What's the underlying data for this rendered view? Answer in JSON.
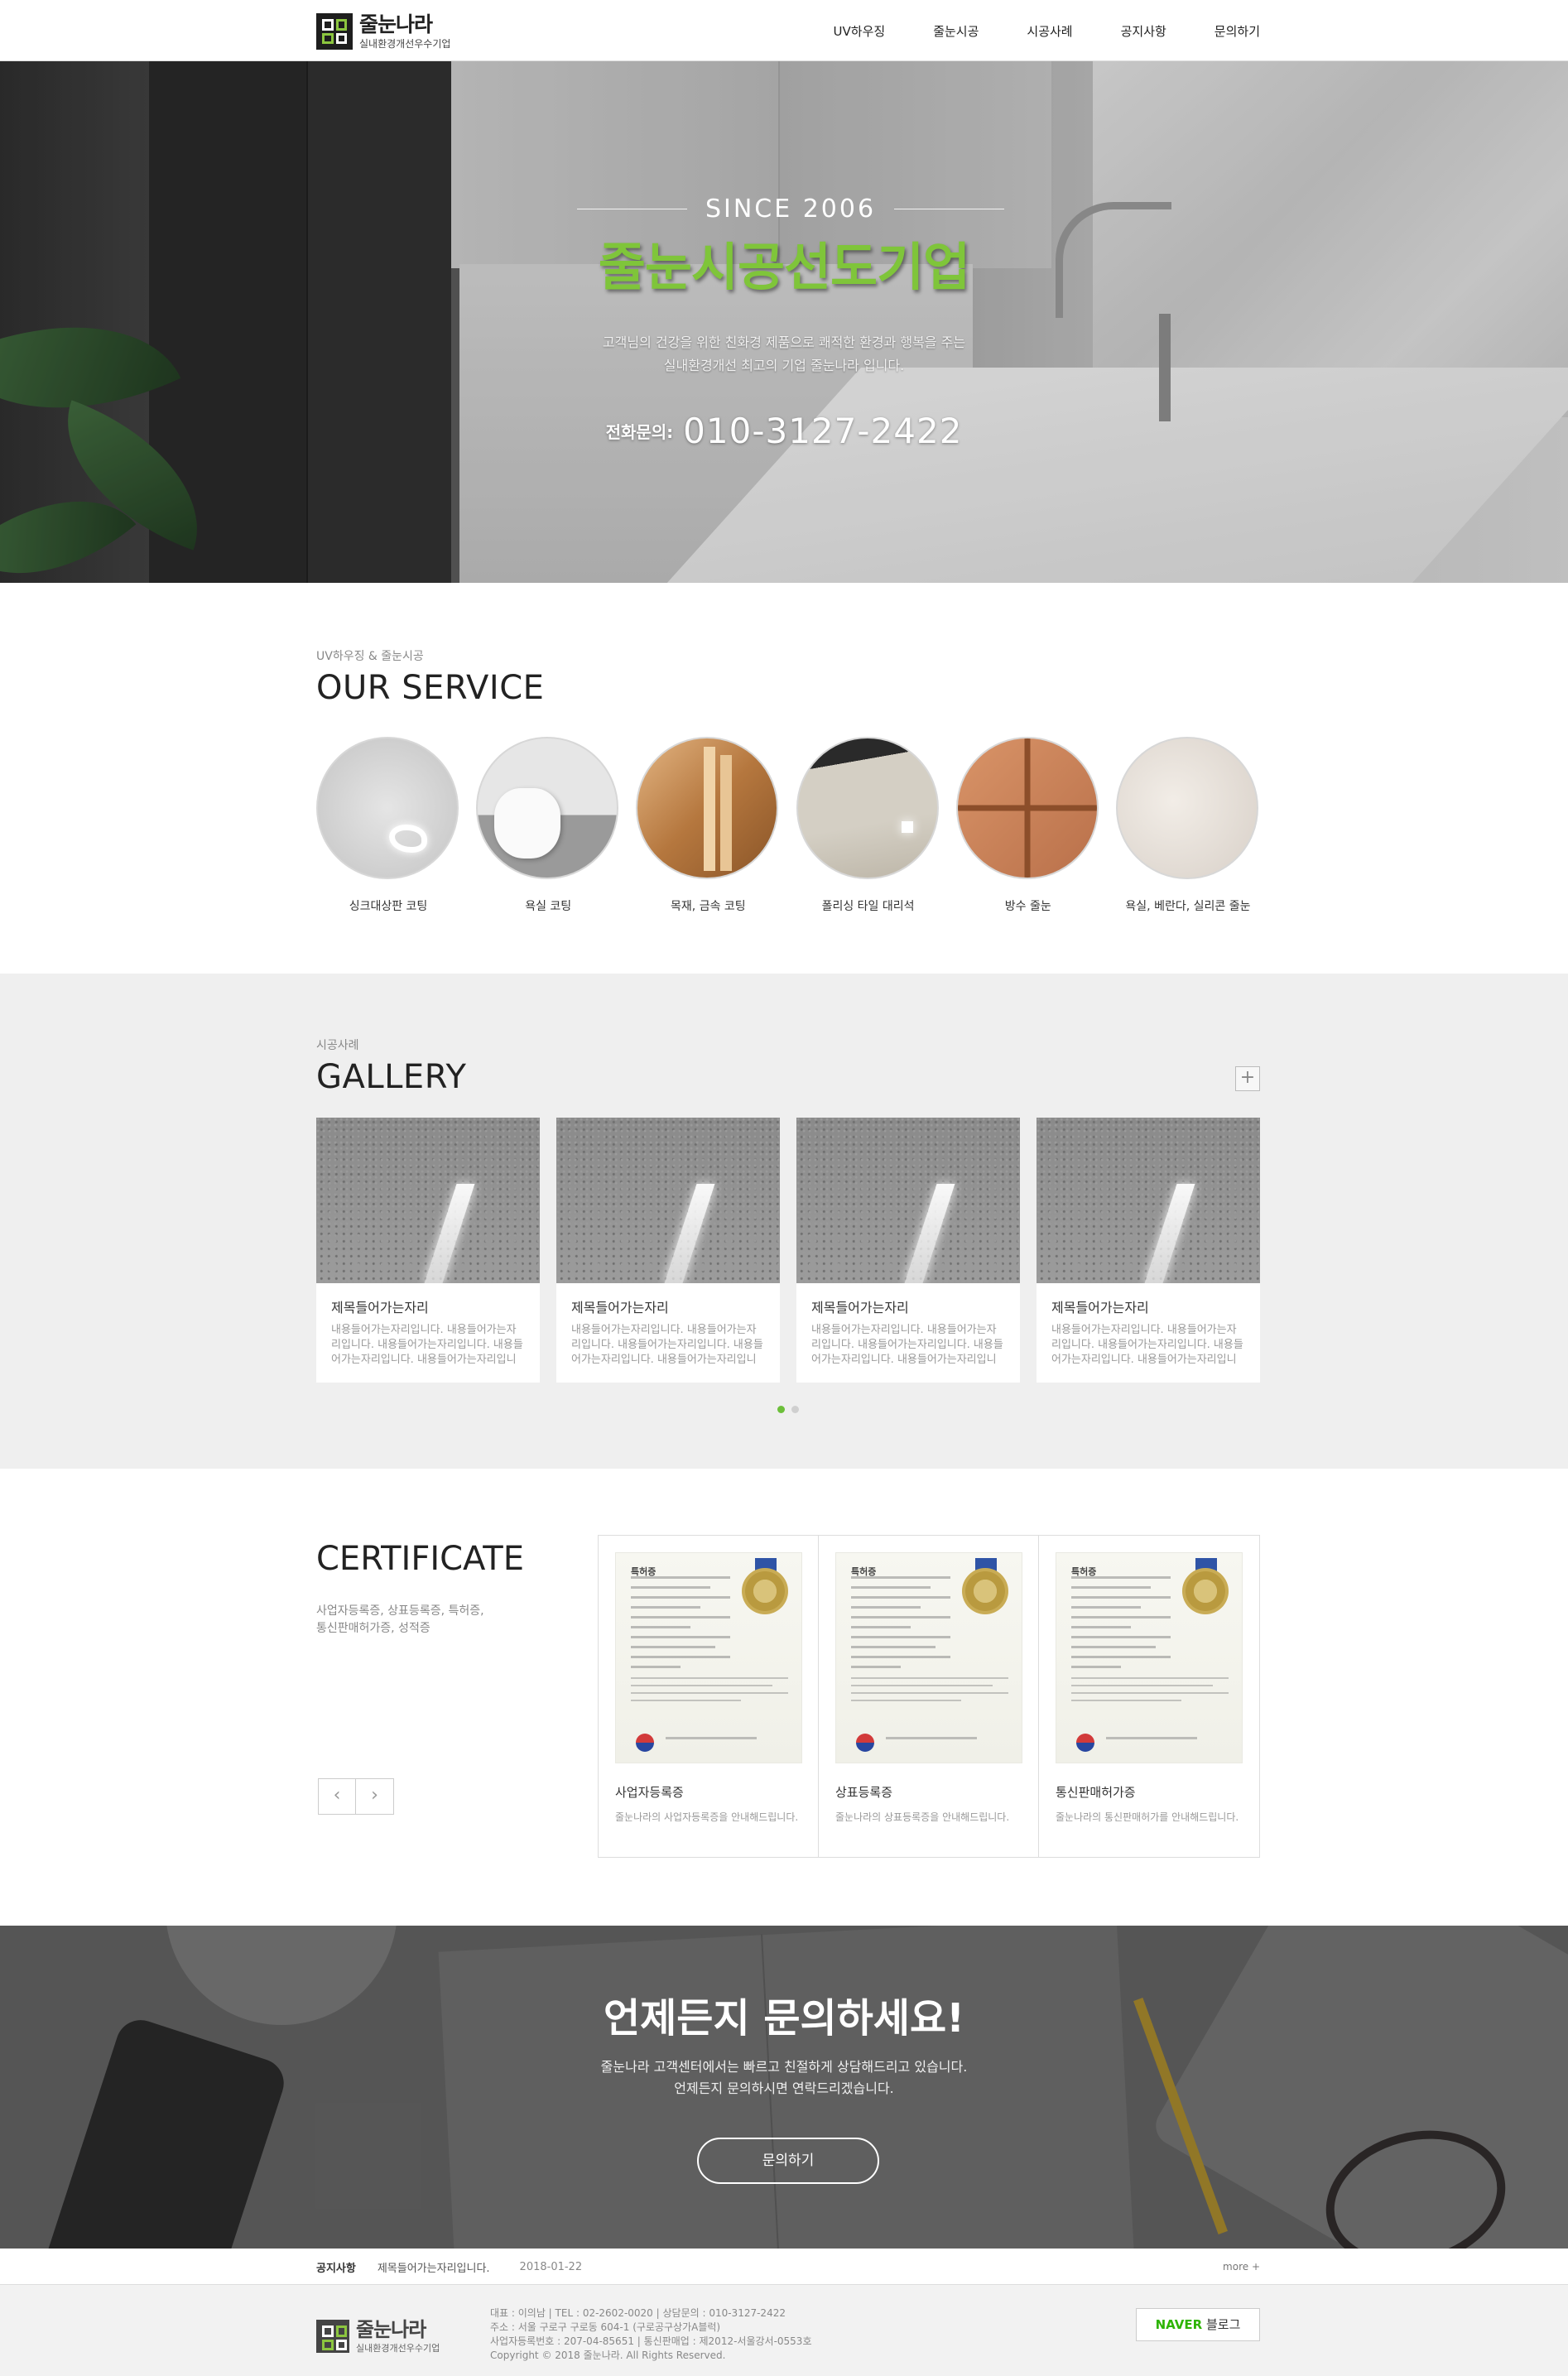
{
  "brand": {
    "name": "줄눈나라",
    "tagline": "실내환경개선우수기업"
  },
  "nav": [
    "UV하우징",
    "줄눈시공",
    "시공사례",
    "공지사항",
    "문의하기"
  ],
  "hero": {
    "since": "SINCE 2006",
    "title": "줄눈시공선도기업",
    "desc_line1": "고객님의 건강을 위한 친화경 제품으로 쾌적한 환경과 행복을 주는",
    "desc_line2": "실내환경개선 최고의 기업 줄눈나라 입니다.",
    "phone_label": "전화문의:",
    "phone": "010-3127-2422"
  },
  "service": {
    "sub": "UV하우징 & 줄눈시공",
    "title": "OUR SERVICE",
    "items": [
      "싱크대상판 코팅",
      "욕실 코팅",
      "목재, 금속 코팅",
      "폴리싱 타일 대리석",
      "방수 줄눈",
      "욕실, 베란다, 실리콘 줄눈"
    ]
  },
  "gallery": {
    "sub": "시공사례",
    "title": "GALLERY",
    "more_icon": "+",
    "cards": [
      {
        "title": "제목들어가는자리",
        "text": "내용들어가는자리입니다. 내용들어가는자리입니다. 내용들어가는자리입니다. 내용들어가는자리입니다. 내용들어가는자리입니다."
      },
      {
        "title": "제목들어가는자리",
        "text": "내용들어가는자리입니다. 내용들어가는자리입니다. 내용들어가는자리입니다. 내용들어가는자리입니다. 내용들어가는자리입니다."
      },
      {
        "title": "제목들어가는자리",
        "text": "내용들어가는자리입니다. 내용들어가는자리입니다. 내용들어가는자리입니다. 내용들어가는자리입니다. 내용들어가는자리입니다."
      },
      {
        "title": "제목들어가는자리",
        "text": "내용들어가는자리입니다. 내용들어가는자리입니다. 내용들어가는자리입니다. 내용들어가는자리입니다. 내용들어가는자리입니다."
      }
    ],
    "active_page": 1,
    "pages": 2
  },
  "certificate": {
    "title": "CERTIFICATE",
    "desc_line1": "사업자등록증, 상표등록증, 특허증,",
    "desc_line2": "통신판매허가증, 성적증",
    "prev_icon": "‹",
    "next_icon": "›",
    "doc_head": "특허증",
    "items": [
      {
        "name": "사업자등록증",
        "text": "줄눈나라의 사업자등록증을 안내해드립니다."
      },
      {
        "name": "상표등록증",
        "text": "줄눈나라의 상표등록증을 안내해드립니다."
      },
      {
        "name": "통신판매허가증",
        "text": "줄눈나라의 통신판매허가를 안내해드립니다."
      }
    ]
  },
  "contact": {
    "title": "언제든지 문의하세요!",
    "desc_line1": "줄눈나라 고객센터에서는 빠르고 친절하게 상담해드리고 있습니다.",
    "desc_line2": "언제든지 문의하시면 연락드리겠습니다.",
    "button": "문의하기"
  },
  "notice": {
    "label": "공지사항",
    "item": "제목들어가는자리입니다.",
    "date": "2018-01-22",
    "more": "more +"
  },
  "footer": {
    "line1": "대표 : 이의남  |  TEL : 02-2602-0020  |  상담문의 : 010-3127-2422",
    "line2": "주소 : 서울 구로구 구로동 604-1 (구로공구상가A블럭)",
    "line3": "사업자등록번호 : 207-04-85651  |  통신판매업 : 제2012-서울강서-0553호",
    "line4": "Copyright © 2018 줄눈나라. All Rights Reserved.",
    "naver_brand": "NAVER",
    "naver_label": "블로그"
  },
  "colors": {
    "accent": "#7fc53a",
    "dot_active": "#6cbf3a"
  }
}
